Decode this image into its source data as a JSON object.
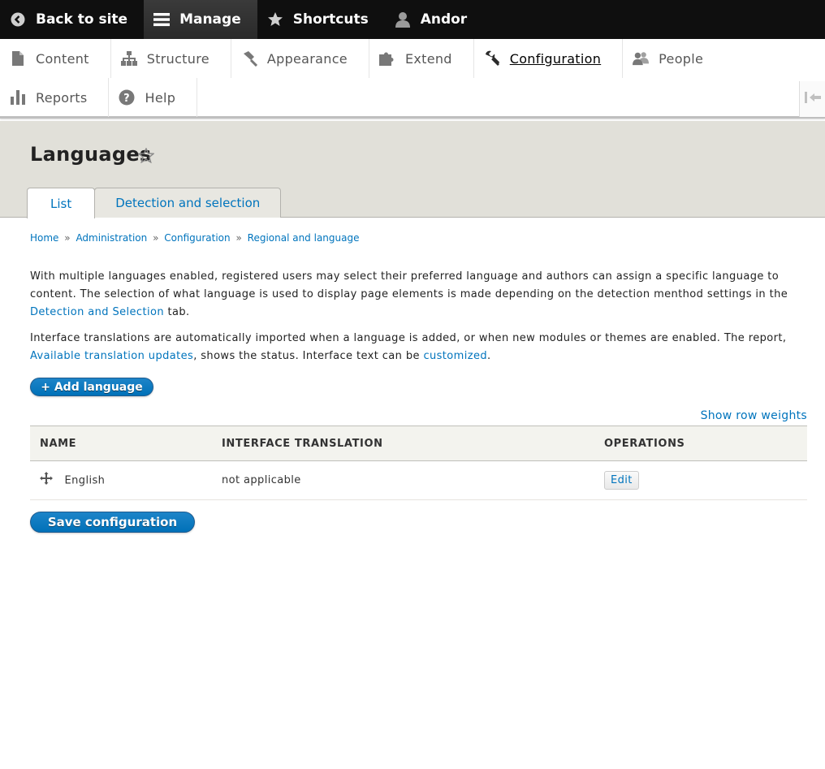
{
  "toolbar": {
    "back_label": "Back to site",
    "manage_label": "Manage",
    "shortcuts_label": "Shortcuts",
    "user_label": "Andor"
  },
  "tray": {
    "row1": [
      {
        "label": "Content",
        "icon": "file-icon"
      },
      {
        "label": "Structure",
        "icon": "sitemap-icon"
      },
      {
        "label": "Appearance",
        "icon": "paintbrush-icon"
      },
      {
        "label": "Extend",
        "icon": "puzzle-icon"
      },
      {
        "label": "Configuration",
        "icon": "wrench-icon"
      },
      {
        "label": "People",
        "icon": "people-icon"
      }
    ],
    "row2": [
      {
        "label": "Reports",
        "icon": "bar-chart-icon"
      },
      {
        "label": "Help",
        "icon": "help-icon"
      }
    ],
    "current": "Configuration"
  },
  "page": {
    "title": "Languages",
    "tabs": [
      {
        "label": "List",
        "active": true
      },
      {
        "label": "Detection and selection",
        "active": false
      }
    ]
  },
  "breadcrumb": {
    "items": [
      "Home",
      "Administration",
      "Configuration",
      "Regional and language"
    ],
    "separator": "»"
  },
  "description": {
    "p1_text": "With multiple languages enabled, registered users may select their preferred language and authors can assign a specific language to content. The selection of what language is used to display page elements is made depending on the detection menthod settings in the ",
    "p1_link": "Detection and Selection",
    "p1_tail": " tab.",
    "p2_text": "Interface translations are automatically imported when a language is added, or when new modules or themes are enabled. The report, ",
    "p2_link1": "Available translation updates",
    "p2_mid": ", shows the status. Interface text can be ",
    "p2_link2": "customized",
    "p2_tail": "."
  },
  "actions": {
    "add_language": "+ Add language",
    "show_row_weights": "Show row weights",
    "save_configuration": "Save configuration"
  },
  "table": {
    "headers": [
      "NAME",
      "INTERFACE TRANSLATION",
      "OPERATIONS"
    ],
    "rows": [
      {
        "name": "English",
        "translation": "not applicable",
        "operation": "Edit"
      }
    ]
  },
  "colors": {
    "toolbar_bg": "#0f0f0f",
    "link": "#0074bd",
    "header_bg": "#e1e0d9",
    "primary_button": "#0071b8"
  }
}
